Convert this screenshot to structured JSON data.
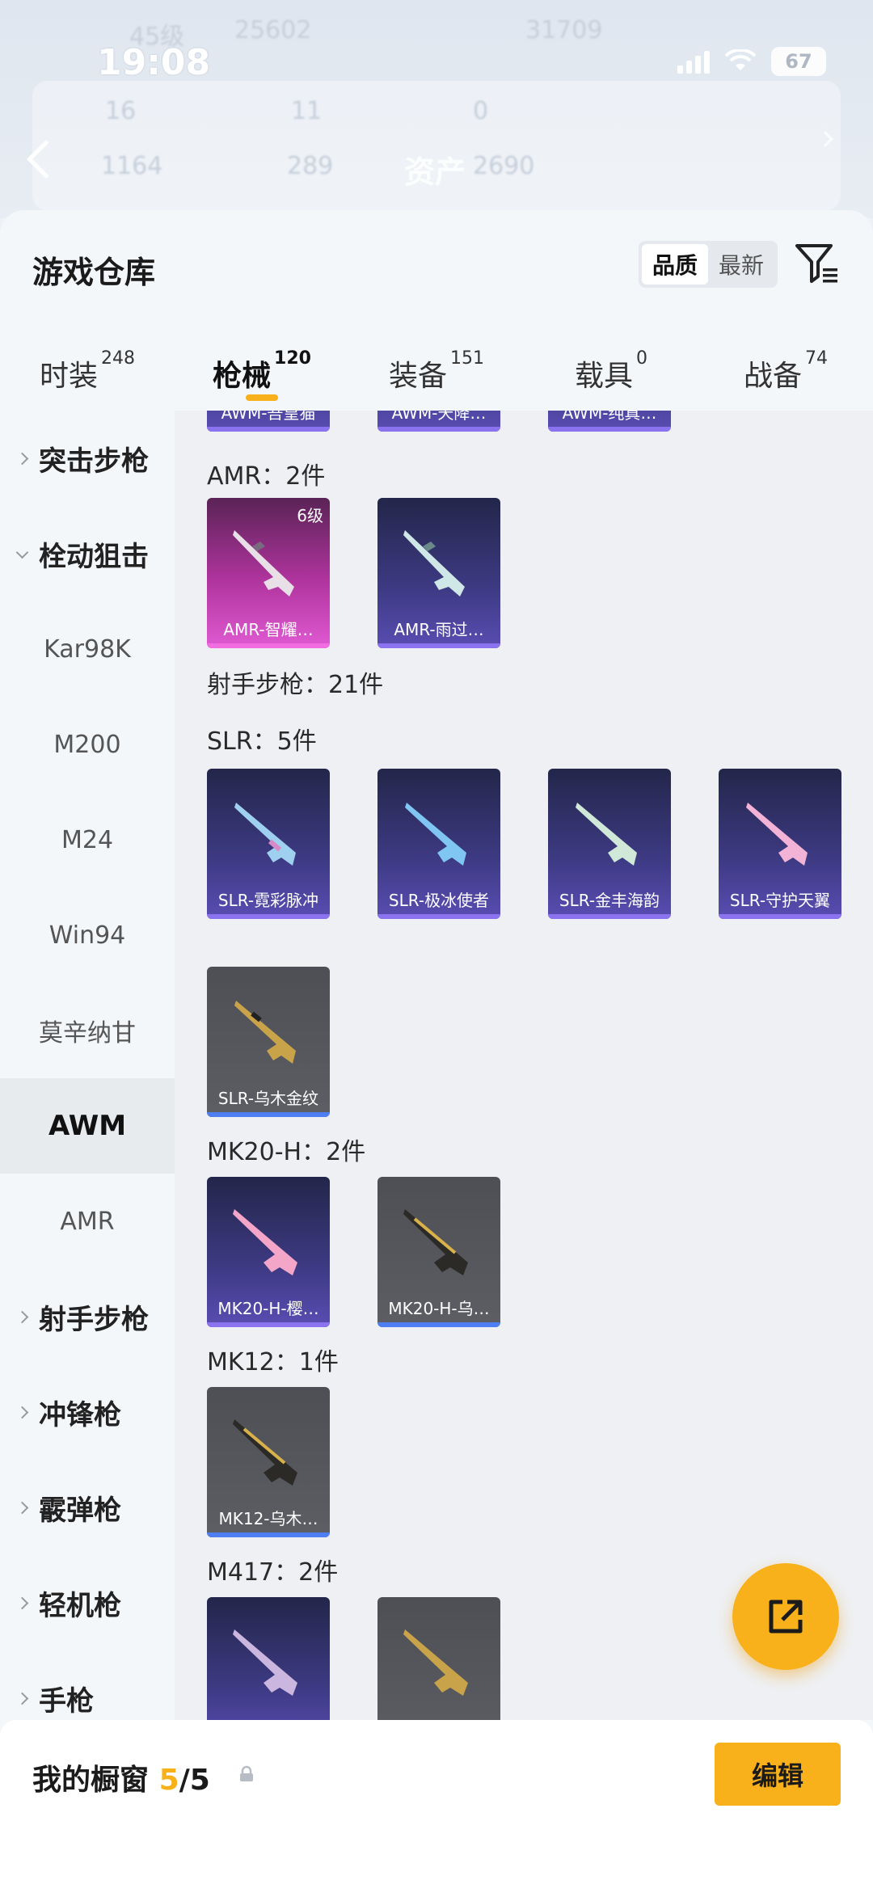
{
  "status": {
    "time": "19:08",
    "battery": "67"
  },
  "header_bg": {
    "level": "45级",
    "coins": "25602",
    "points": "31709",
    "stat1": "16",
    "stat2": "11",
    "stat3": "0",
    "stat4": "1164",
    "stat5": "289",
    "assets_label": "资产",
    "assets_value": "2690"
  },
  "sheet": {
    "title": "游戏仓库",
    "sort": {
      "quality": "品质",
      "latest": "最新"
    }
  },
  "tabs": [
    {
      "label": "时装",
      "count": "248"
    },
    {
      "label": "枪械",
      "count": "120"
    },
    {
      "label": "装备",
      "count": "151"
    },
    {
      "label": "载具",
      "count": "0"
    },
    {
      "label": "战备",
      "count": "74"
    }
  ],
  "sidebar": [
    {
      "label": "突击步枪"
    },
    {
      "label": "栓动狙击"
    },
    {
      "label": "Kar98K"
    },
    {
      "label": "M200"
    },
    {
      "label": "M24"
    },
    {
      "label": "Win94"
    },
    {
      "label": "莫辛纳甘"
    },
    {
      "label": "AWM"
    },
    {
      "label": "AMR"
    },
    {
      "label": "射手步枪"
    },
    {
      "label": "冲锋枪"
    },
    {
      "label": "霰弹枪"
    },
    {
      "label": "轻机枪"
    },
    {
      "label": "手枪"
    }
  ],
  "content": {
    "awm_cards": [
      "AWM-吾皇猫",
      "AWM-天降…",
      "AWM-纯真…"
    ],
    "amr_label": "AMR：2件",
    "amr_cards": [
      {
        "name": "AMR-智耀…",
        "level": "6级"
      },
      {
        "name": "AMR-雨过…"
      }
    ],
    "marksman_label": "射手步枪：21件",
    "slr_label": "SLR：5件",
    "slr_cards": [
      "SLR-霓彩脉冲",
      "SLR-极冰使者",
      "SLR-金丰海韵",
      "SLR-守护天翼",
      "SLR-乌木金纹"
    ],
    "mk20_label": "MK20-H：2件",
    "mk20_cards": [
      "MK20-H-樱…",
      "MK20-H-乌…"
    ],
    "mk12_label": "MK12：1件",
    "mk12_cards": [
      "MK12-乌木…"
    ],
    "m417_label": "M417：2件"
  },
  "bottom": {
    "window_label": "我的橱窗",
    "window_count": "5",
    "window_total": "/5",
    "edit": "编辑"
  },
  "colors": {
    "accent": "#f8b11a",
    "purple_card": "#3d3a83",
    "pink_card": "#b0349e",
    "grey_card": "#5c5e64"
  }
}
